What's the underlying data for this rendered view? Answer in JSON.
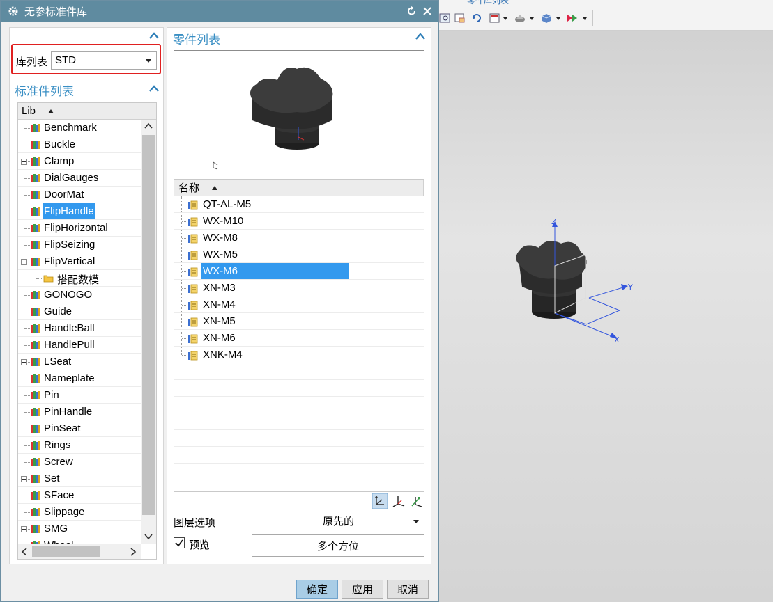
{
  "dialog": {
    "title": "无参标准件库",
    "colors": {
      "titlebar": "#5f8ba0",
      "accent": "#3a8fc4",
      "selection": "#3399ee",
      "highlight_box": "#e02020"
    }
  },
  "library_selector": {
    "label": "库列表",
    "value": "STD"
  },
  "standard_list": {
    "title": "标准件列表",
    "column": "Lib",
    "items": [
      {
        "label": "Benchmark",
        "expandable": false
      },
      {
        "label": "Buckle",
        "expandable": false
      },
      {
        "label": "Clamp",
        "expandable": true
      },
      {
        "label": "DialGauges",
        "expandable": false
      },
      {
        "label": "DoorMat",
        "expandable": false
      },
      {
        "label": "FlipHandle",
        "expandable": false,
        "selected": true
      },
      {
        "label": "FlipHorizontal",
        "expandable": false
      },
      {
        "label": "FlipSeizing",
        "expandable": false
      },
      {
        "label": "FlipVertical",
        "expanded": true
      },
      {
        "label": "搭配数模",
        "child": true
      },
      {
        "label": "GONOGO",
        "expandable": false
      },
      {
        "label": "Guide",
        "expandable": false
      },
      {
        "label": "HandleBall",
        "expandable": false
      },
      {
        "label": "HandlePull",
        "expandable": false
      },
      {
        "label": "LSeat",
        "expandable": true
      },
      {
        "label": "Nameplate",
        "expandable": false
      },
      {
        "label": "Pin",
        "expandable": false
      },
      {
        "label": "PinHandle",
        "expandable": false
      },
      {
        "label": "PinSeat",
        "expandable": false
      },
      {
        "label": "Rings",
        "expandable": false
      },
      {
        "label": "Screw",
        "expandable": false
      },
      {
        "label": "Set",
        "expandable": true
      },
      {
        "label": "SFace",
        "expandable": false
      },
      {
        "label": "Slippage",
        "expandable": false
      },
      {
        "label": "SMG",
        "expandable": true
      },
      {
        "label": "Wheel",
        "expandable": false
      }
    ]
  },
  "part_list": {
    "title": "零件列表",
    "column": "名称",
    "items": [
      "QT-AL-M5",
      "WX-M10",
      "WX-M8",
      "WX-M5",
      "WX-M6",
      "XN-M3",
      "XN-M4",
      "XN-M5",
      "XN-M6",
      "XNK-M4"
    ],
    "selected_index": 4
  },
  "layer_option": {
    "label": "图层选项",
    "value": "原先的"
  },
  "preview": {
    "label": "预览",
    "checked": true
  },
  "multi_orient_button": "多个方位",
  "buttons": {
    "ok": "确定",
    "apply": "应用",
    "cancel": "取消"
  },
  "toolbar": {
    "cut_title": "零件库列表"
  },
  "axes": {
    "x": "X",
    "y": "Y",
    "z": "Z"
  }
}
